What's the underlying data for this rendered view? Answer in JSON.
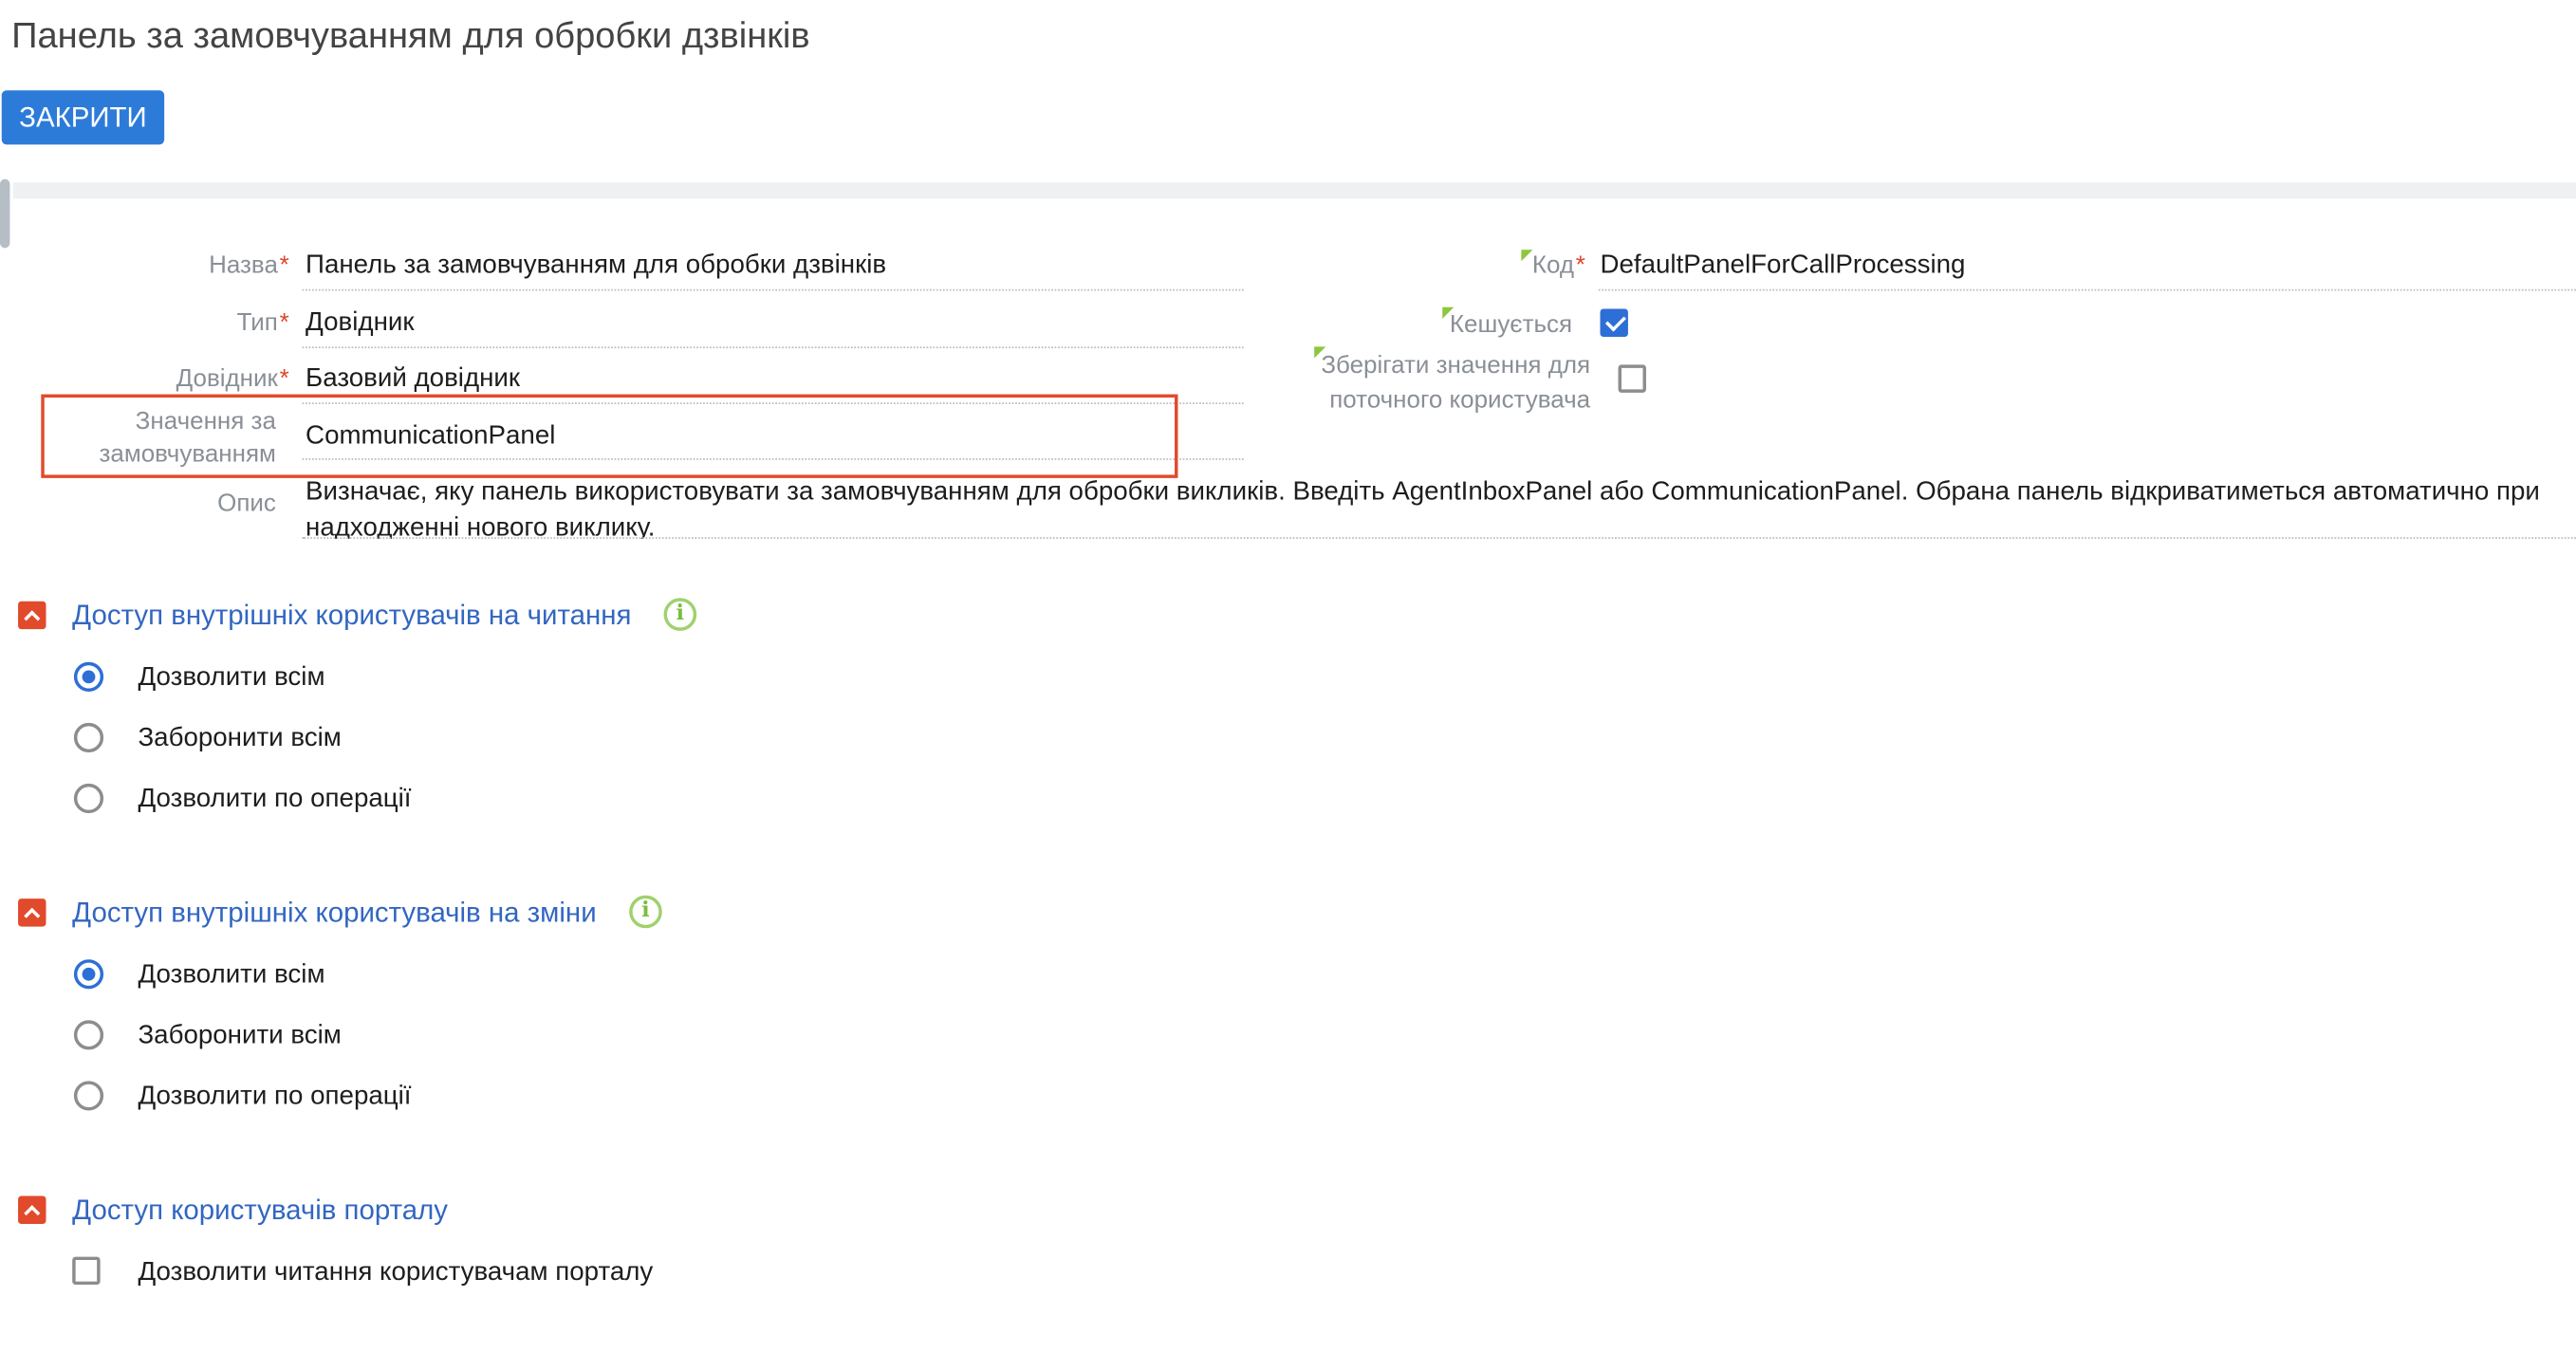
{
  "page": {
    "title": "Панель за замовчуванням для обробки дзвінків",
    "close_button": "ЗАКРИТИ"
  },
  "form": {
    "name": {
      "label": "Назва",
      "value": "Панель за замовчуванням для обробки дзвінків"
    },
    "type": {
      "label": "Тип",
      "value": "Довідник"
    },
    "lookup": {
      "label": "Довідник",
      "value": "Базовий довідник"
    },
    "default_value": {
      "label_line1": "Значення за",
      "label_line2": "замовчуванням",
      "value": "CommunicationPanel"
    },
    "description": {
      "label": "Опис",
      "value": "Визначає, яку панель використовувати за замовчуванням для обробки викликів. Введіть AgentInboxPanel або CommunicationPanel. Обрана панель відкриватиметься автоматично при надходженні нового виклику."
    },
    "code": {
      "label": "Код",
      "value": "DefaultPanelForCallProcessing"
    },
    "cached": {
      "label": "Кешується",
      "checked": true
    },
    "per_user": {
      "label_line1": "Зберігати значення для",
      "label_line2": "поточного користувача",
      "checked": false
    }
  },
  "sections": {
    "read_access": {
      "title": "Доступ внутрішніх користувачів на читання",
      "info_icon": "info-icon",
      "options": [
        "Дозволити всім",
        "Заборонити всім",
        "Дозволити по операції"
      ],
      "selected": 0
    },
    "edit_access": {
      "title": "Доступ внутрішніх користувачів на зміни",
      "info_icon": "info-icon",
      "options": [
        "Дозволити всім",
        "Заборонити всім",
        "Дозволити по операції"
      ],
      "selected": 0
    },
    "portal_access": {
      "title": "Доступ користувачів порталу",
      "checkbox_label": "Дозволити читання користувачам порталу",
      "checked": false
    }
  },
  "colors": {
    "accent_blue": "#2d7bd9",
    "checkbox_blue": "#2d6fd6",
    "section_title": "#3266c1",
    "required_red": "#e0452b",
    "toggle_red": "#e24a2c",
    "info_green": "#9fd16d"
  }
}
